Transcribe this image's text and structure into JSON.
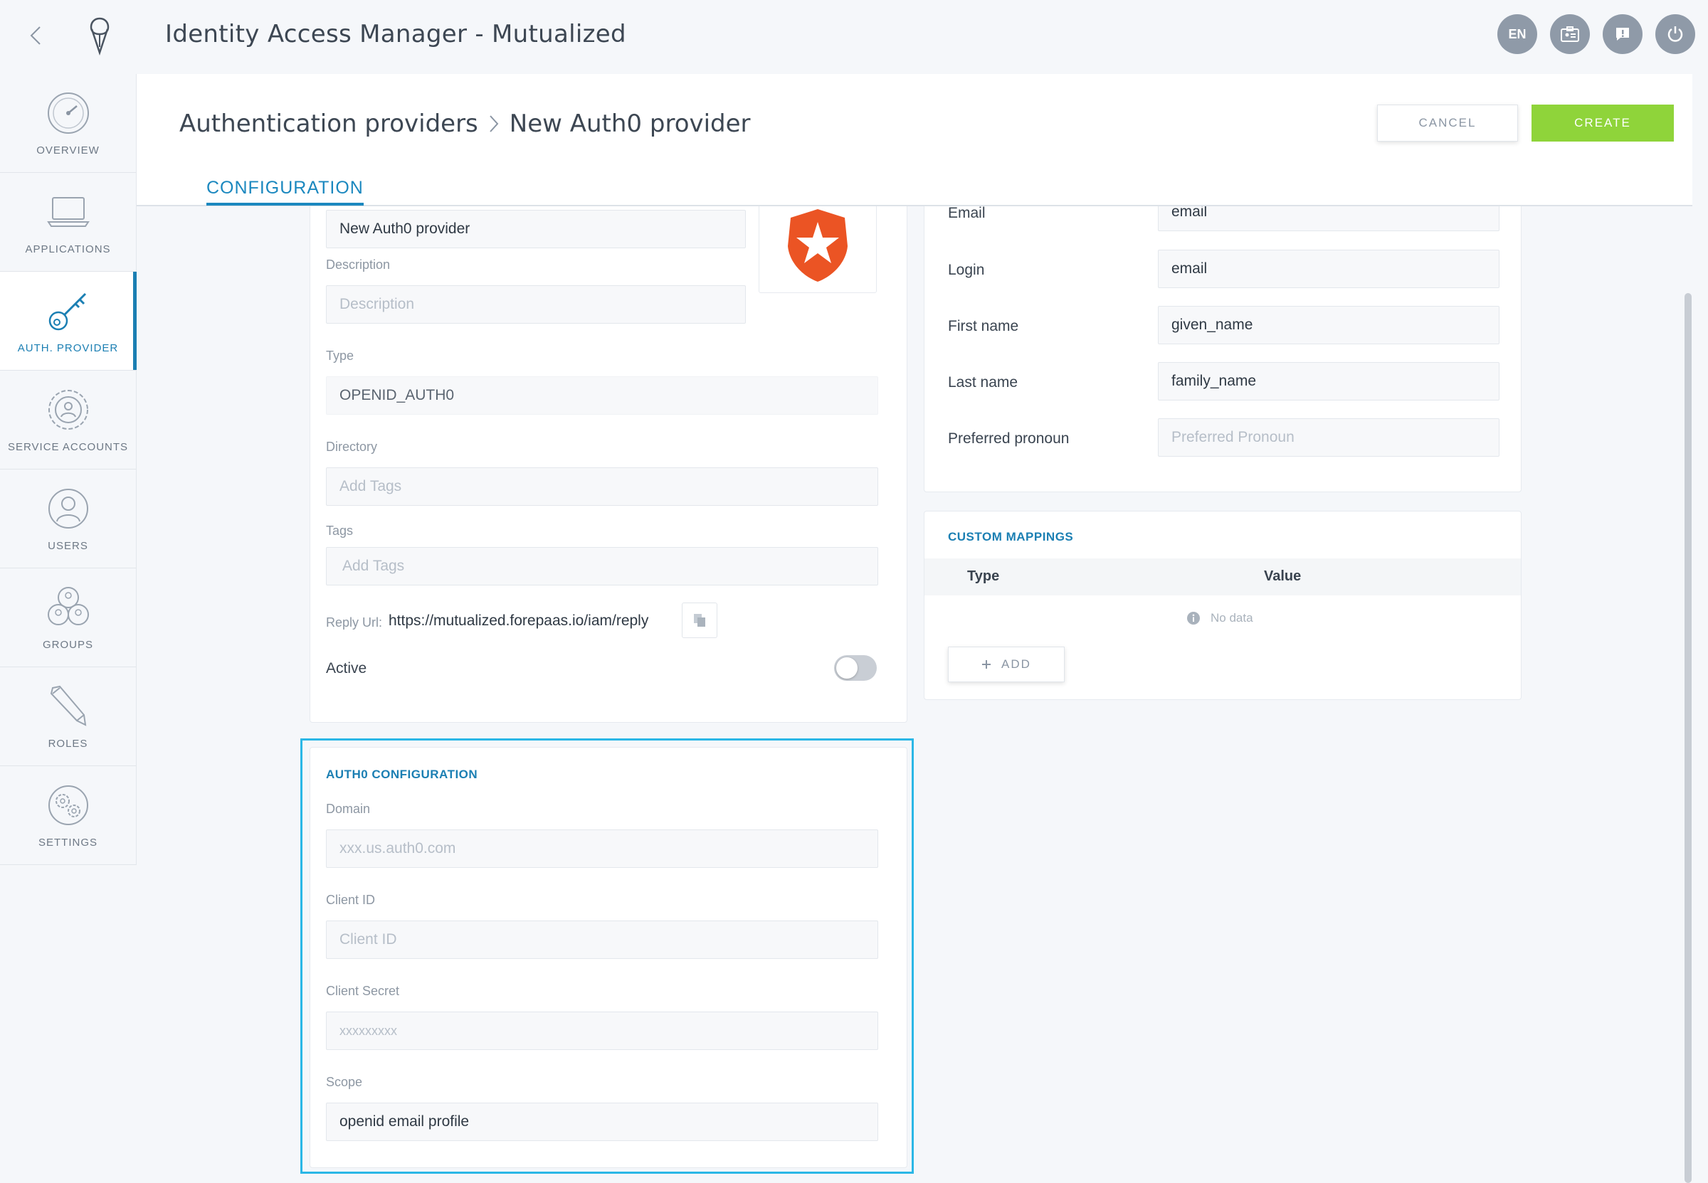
{
  "app": {
    "title": "Identity Access Manager - Mutualized"
  },
  "top_actions": {
    "lang": "EN"
  },
  "sidebar": {
    "items": [
      {
        "label": "OVERVIEW"
      },
      {
        "label": "APPLICATIONS"
      },
      {
        "label": "AUTH. PROVIDER"
      },
      {
        "label": "SERVICE ACCOUNTS"
      },
      {
        "label": "USERS"
      },
      {
        "label": "GROUPS"
      },
      {
        "label": "ROLES"
      },
      {
        "label": "SETTINGS"
      }
    ]
  },
  "header": {
    "breadcrumb": [
      "Authentication providers",
      "New Auth0 provider"
    ],
    "tab": "CONFIGURATION",
    "cancel_label": "CANCEL",
    "create_label": "CREATE"
  },
  "general": {
    "name_value": "New Auth0 provider",
    "description_label": "Description",
    "description_placeholder": "Description",
    "type_label": "Type",
    "type_value": "OPENID_AUTH0",
    "directory_label": "Directory",
    "directory_placeholder": "Add Tags",
    "tags_label": "Tags",
    "tags_placeholder": "Add Tags",
    "reply_url_label": "Reply Url:",
    "reply_url_value": "https://mutualized.forepaas.io/iam/reply",
    "active_label": "Active"
  },
  "mappings": {
    "rows": [
      {
        "label": "Email",
        "value": "email",
        "placeholder": false
      },
      {
        "label": "Login",
        "value": "email",
        "placeholder": false
      },
      {
        "label": "First name",
        "value": "given_name",
        "placeholder": false
      },
      {
        "label": "Last name",
        "value": "family_name",
        "placeholder": false
      },
      {
        "label": "Preferred pronoun",
        "value": "Preferred Pronoun",
        "placeholder": true
      }
    ]
  },
  "custom_mappings": {
    "title": "CUSTOM MAPPINGS",
    "col_type": "Type",
    "col_value": "Value",
    "empty_text": "No data",
    "add_label": "ADD"
  },
  "auth0_config": {
    "title": "AUTH0 CONFIGURATION",
    "domain_label": "Domain",
    "domain_placeholder": "xxx.us.auth0.com",
    "client_id_label": "Client ID",
    "client_id_placeholder": "Client ID",
    "client_secret_label": "Client Secret",
    "client_secret_placeholder": "xxxxxxxxx",
    "scope_label": "Scope",
    "scope_value": "openid email profile"
  },
  "colors": {
    "accent": "#1b7fb3",
    "create": "#8fd43a",
    "highlight": "#2bb7e6",
    "auth0_logo": "#eb5424"
  }
}
